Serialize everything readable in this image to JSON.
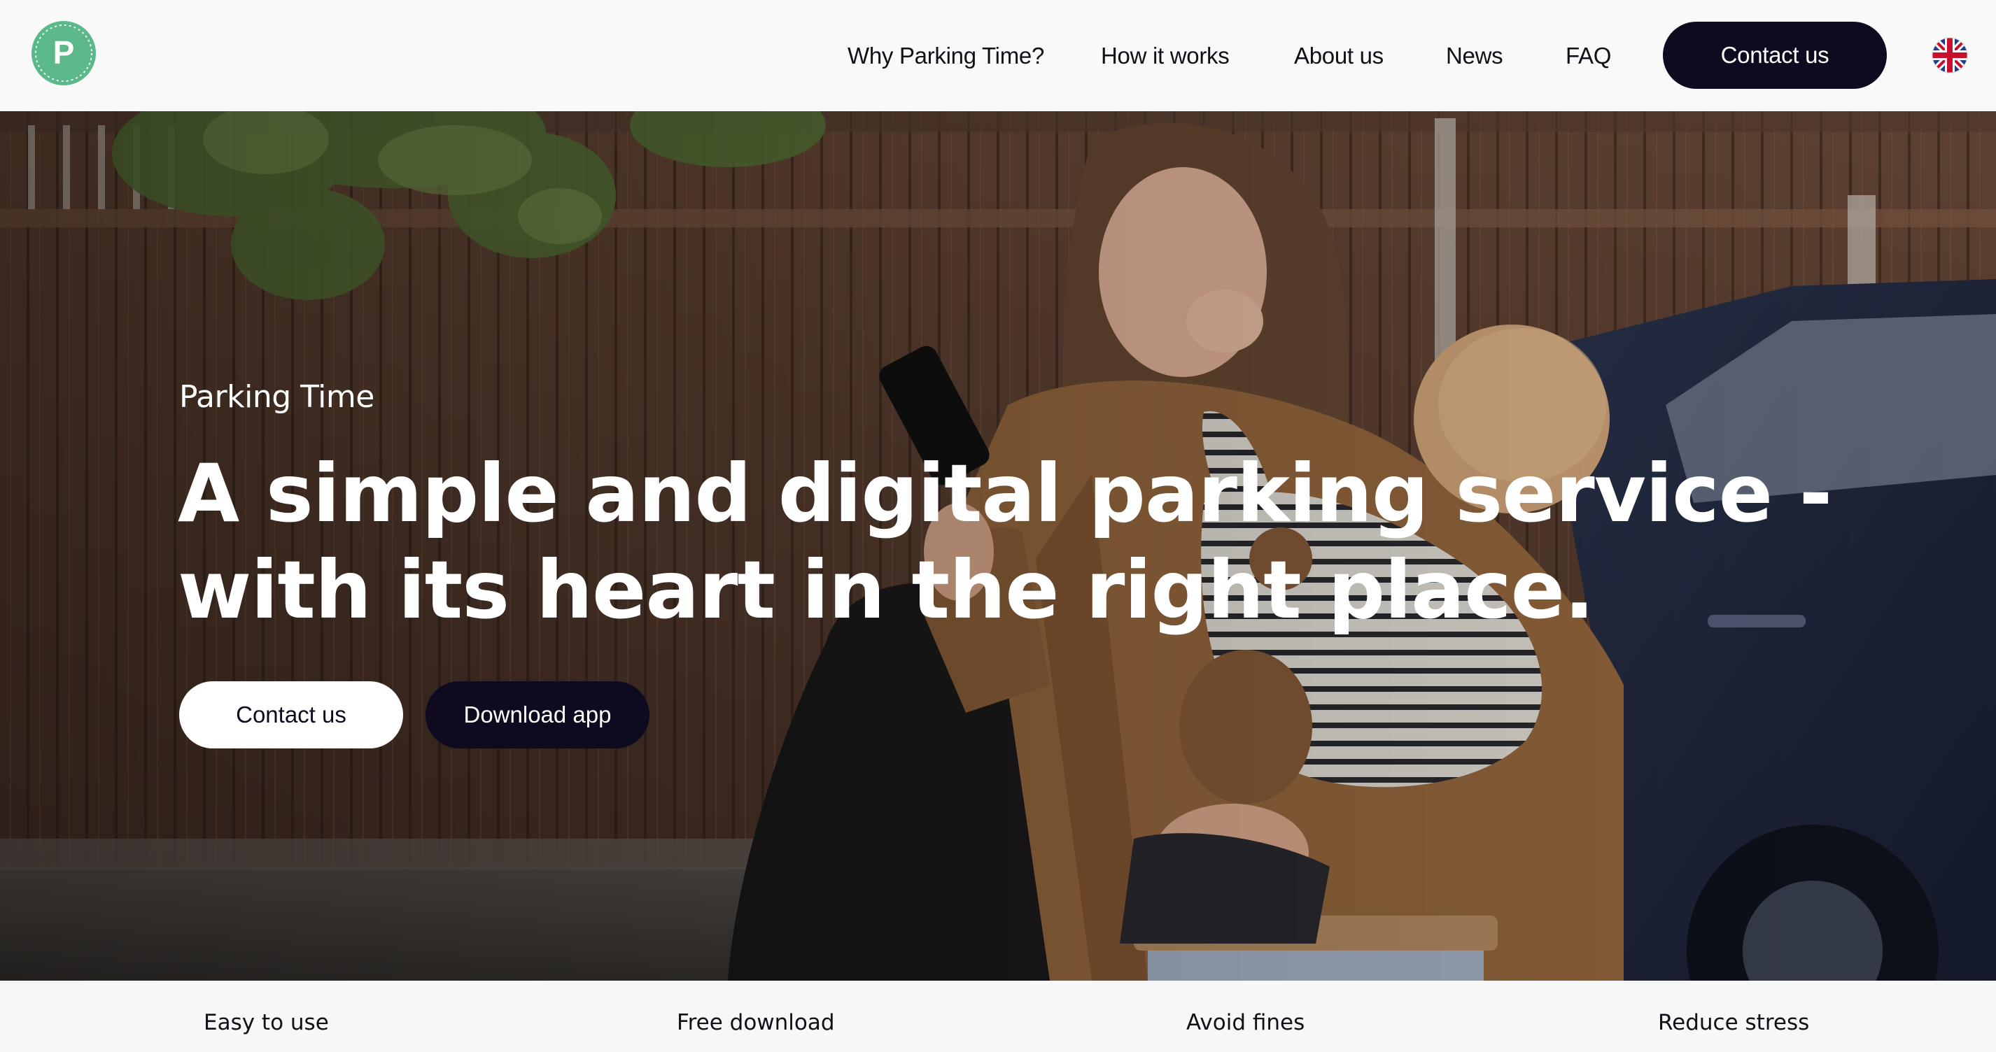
{
  "header": {
    "logo_letter": "P",
    "nav": {
      "why": "Why Parking Time?",
      "how": "How it works",
      "about": "About us",
      "news": "News",
      "faq": "FAQ"
    },
    "contact_label": "Contact us",
    "language_icon": "uk-flag-icon"
  },
  "hero": {
    "eyebrow": "Parking Time",
    "title_line1": "A simple and digital parking service -",
    "title_line2": "with its heart in the right place.",
    "contact_label": "Contact us",
    "download_label": "Download app"
  },
  "features": [
    "Easy to use",
    "Free download",
    "Avoid fines",
    "Reduce stress"
  ],
  "colors": {
    "brand_green": "#5bb88a",
    "dark_navy": "#0e0a1f",
    "white": "#ffffff"
  }
}
